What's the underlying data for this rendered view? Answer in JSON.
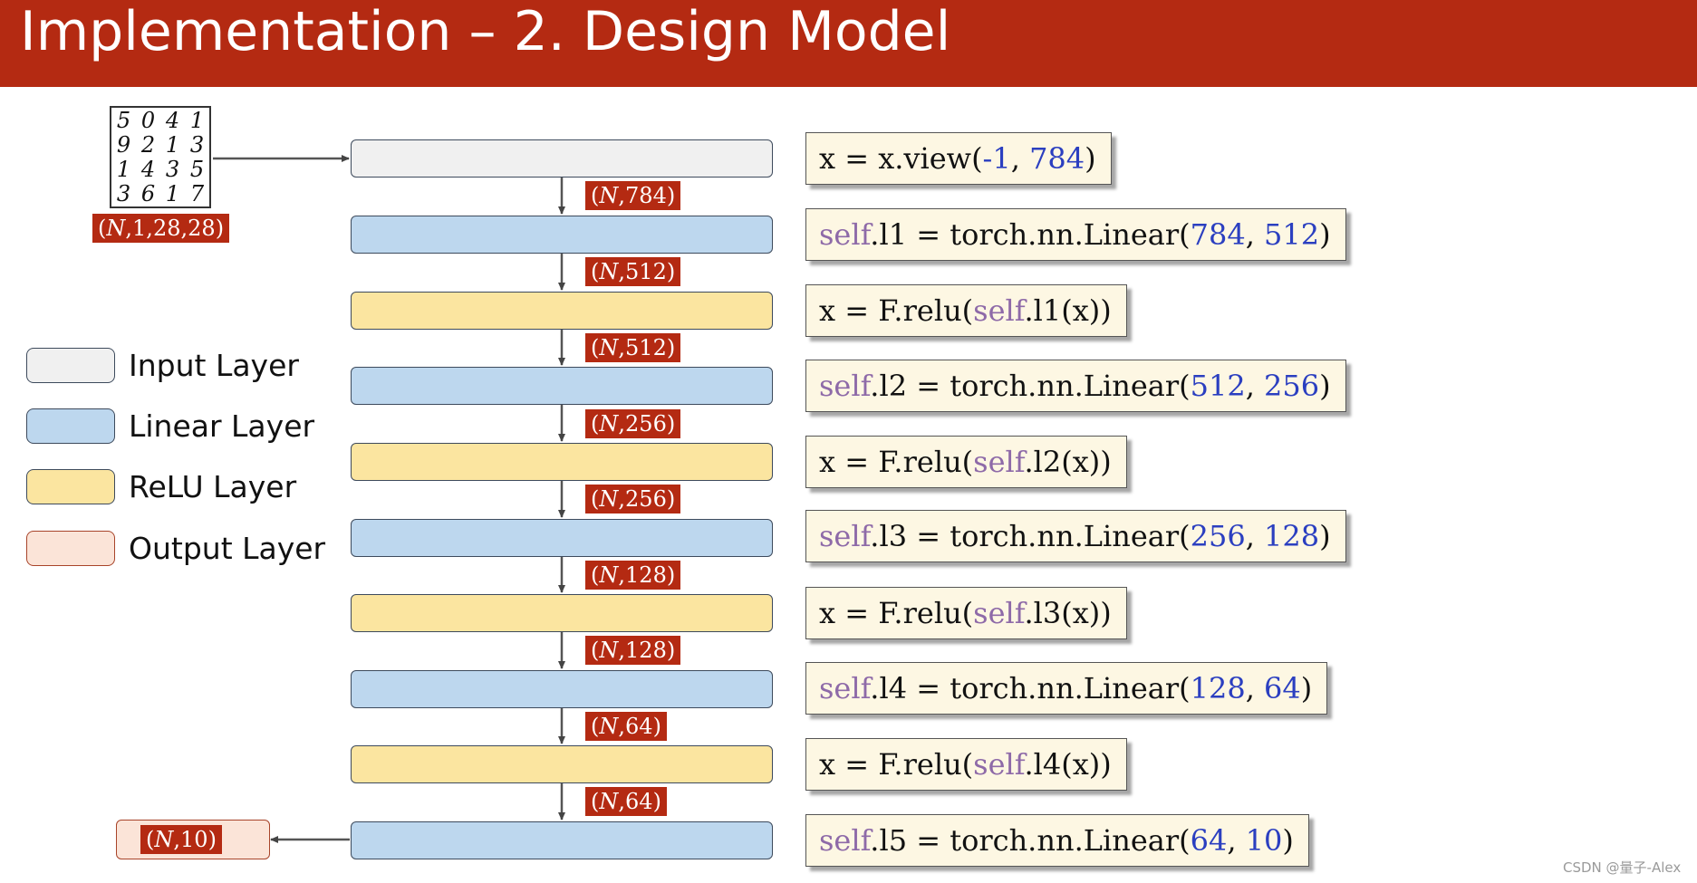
{
  "slide": {
    "title": "Implementation – 2. Design Model",
    "watermark": "CSDN @量子-Alex"
  },
  "input_image": {
    "digits": [
      "5",
      "0",
      "4",
      "1",
      "9",
      "2",
      "1",
      "3",
      "1",
      "4",
      "3",
      "5",
      "3",
      "6",
      "1",
      "7"
    ],
    "shape_label": "(N,1,28,28)"
  },
  "legend": [
    {
      "label": "Input Layer",
      "color": "#f0f0f0"
    },
    {
      "label": "Linear Layer",
      "color": "#bdd7ee"
    },
    {
      "label": "ReLU Layer",
      "color": "#fbe5a0"
    },
    {
      "label": "Output Layer",
      "color": "#fbe4d8"
    }
  ],
  "layers": [
    {
      "type": "input"
    },
    {
      "type": "linear"
    },
    {
      "type": "relu"
    },
    {
      "type": "linear"
    },
    {
      "type": "relu"
    },
    {
      "type": "linear"
    },
    {
      "type": "relu"
    },
    {
      "type": "linear"
    },
    {
      "type": "relu"
    },
    {
      "type": "linear"
    }
  ],
  "shape_labels": [
    "(N,784)",
    "(N,512)",
    "(N,512)",
    "(N,256)",
    "(N,256)",
    "(N,128)",
    "(N,128)",
    "(N,64)",
    "(N,64)"
  ],
  "output_label": "(N,10)",
  "code_lines": [
    "x = x.view(-1, 784)",
    "self.l1 = torch.nn.Linear(784, 512)",
    "x = F.relu(self.l1(x))",
    "self.l2 = torch.nn.Linear(512, 256)",
    "x = F.relu(self.l2(x))",
    "self.l3 = torch.nn.Linear(256, 128)",
    "x = F.relu(self.l3(x))",
    "self.l4 = torch.nn.Linear(128, 64)",
    "x = F.relu(self.l4(x))",
    "self.l5 = torch.nn.Linear(64, 10)"
  ],
  "colors": {
    "title_bar": "#b42a12",
    "tag": "#b42a12",
    "keyword": "#8e6aa8",
    "number": "#2b3fc0",
    "code_bg": "#fdf7e3"
  }
}
